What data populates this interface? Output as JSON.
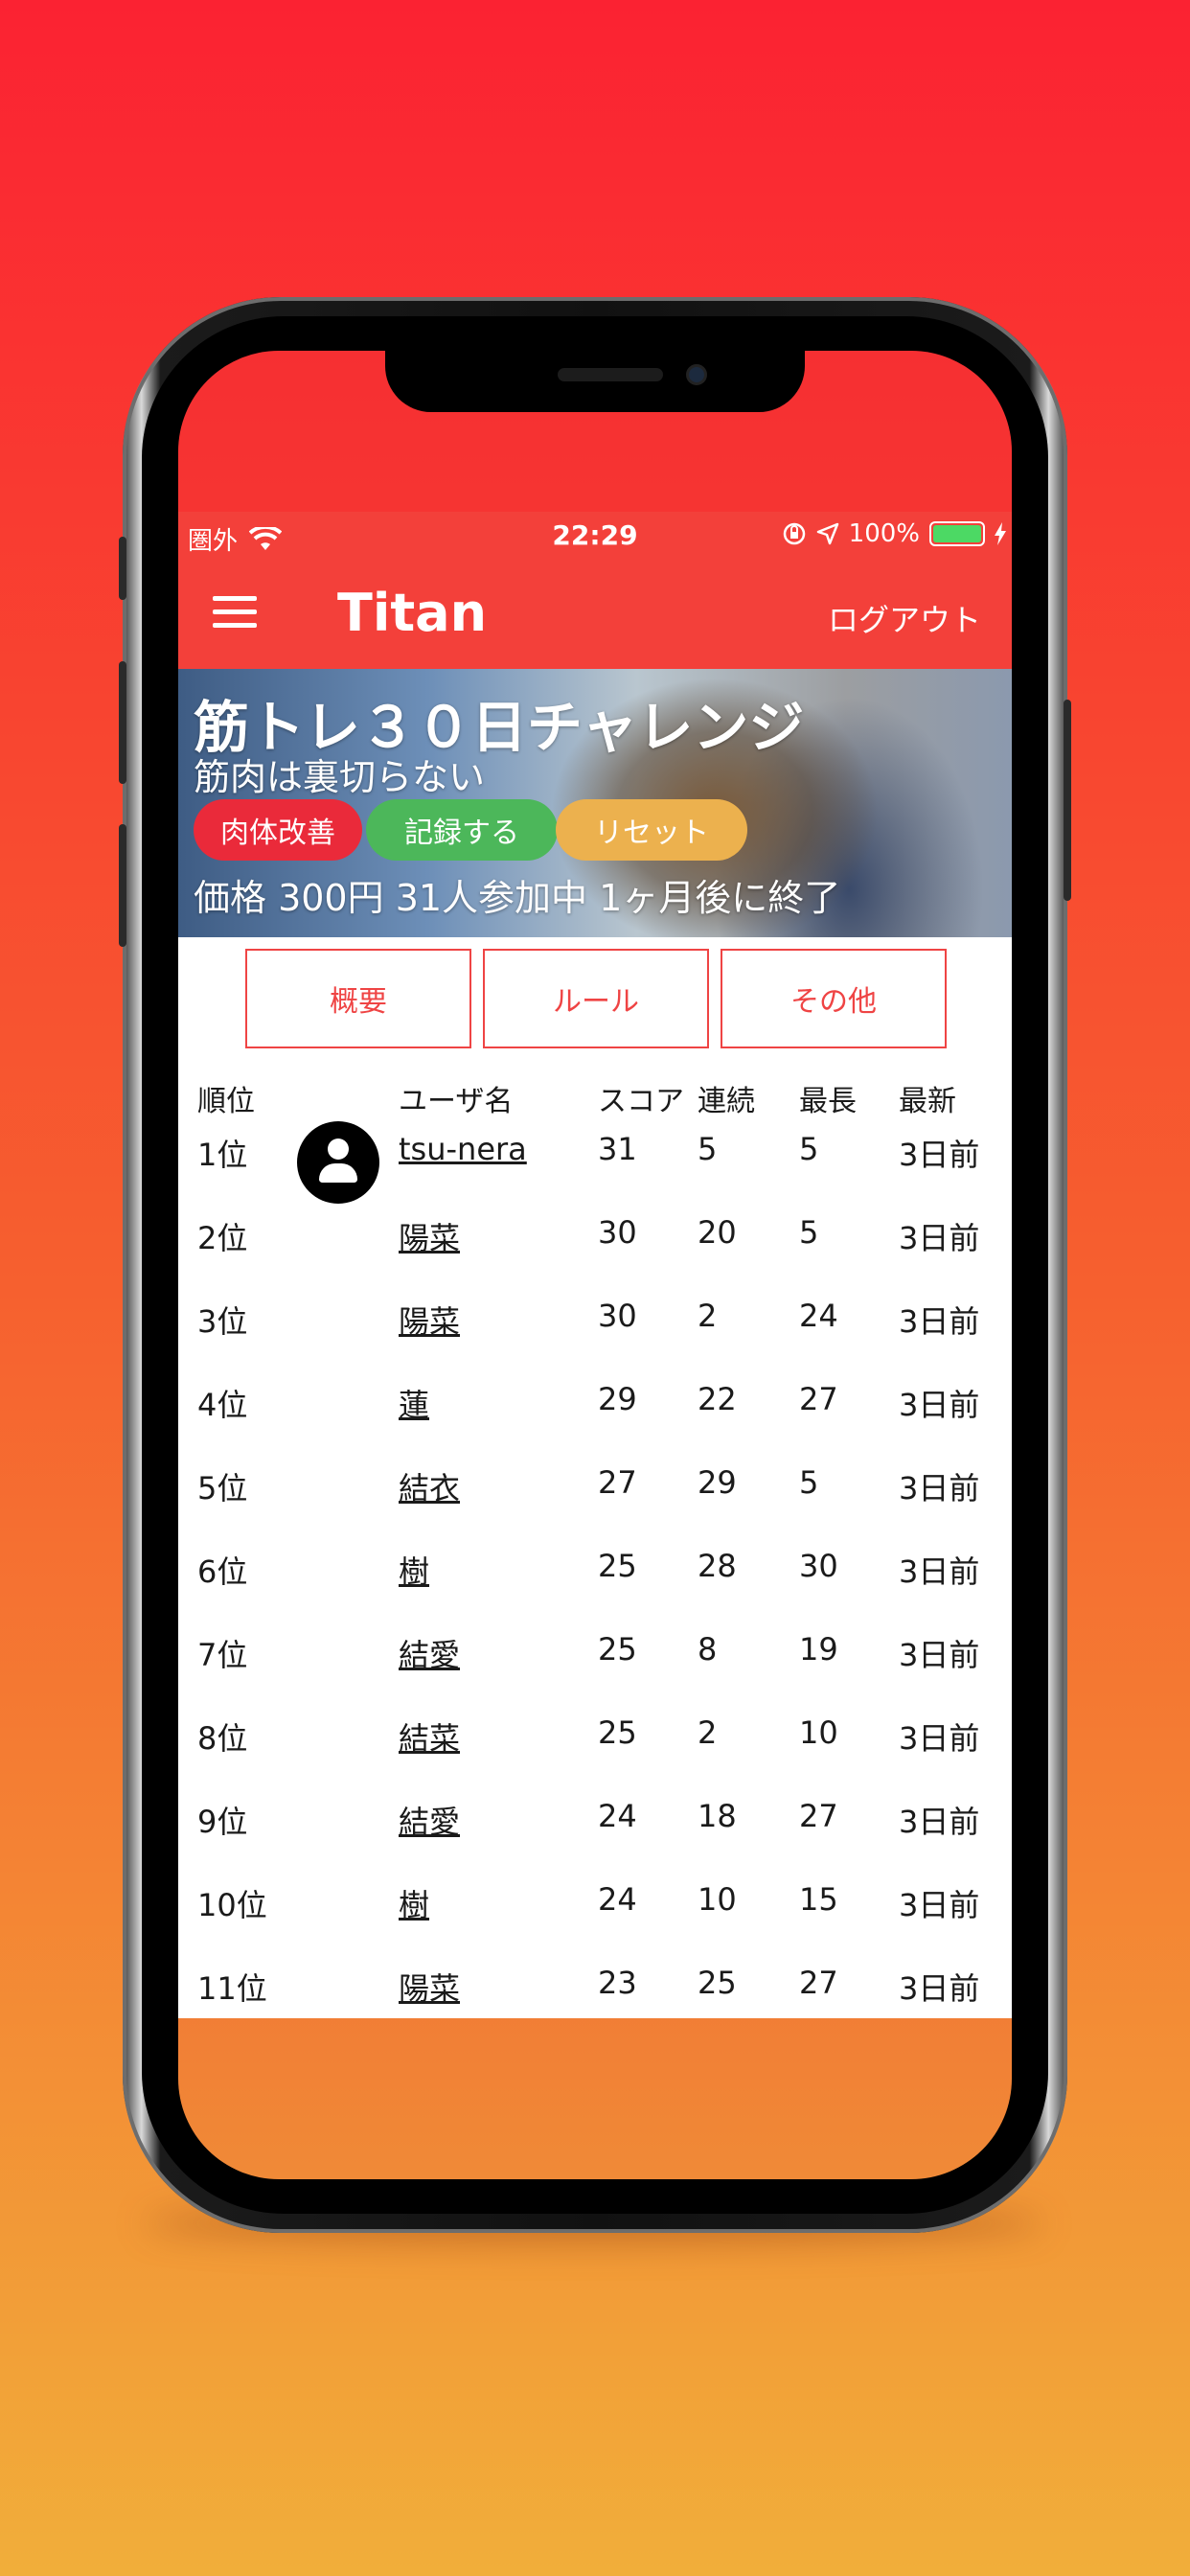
{
  "status_bar": {
    "carrier": "圏外",
    "time": "22:29",
    "battery_percent": "100%"
  },
  "nav": {
    "title": "Titan",
    "logout_label": "ログアウト"
  },
  "banner": {
    "title": "筋トレ３０日チャレンジ",
    "subtitle": "筋肉は裏切らない",
    "tag_label": "肉体改善",
    "record_label": "記録する",
    "reset_label": "リセット",
    "info": "価格 300円 31人参加中 1ヶ月後に終了"
  },
  "tabs": [
    {
      "label": "概要"
    },
    {
      "label": "ルール"
    },
    {
      "label": "その他"
    }
  ],
  "table": {
    "headers": {
      "rank": "順位",
      "name": "ユーザ名",
      "score": "スコア",
      "streak": "連続",
      "max": "最長",
      "last": "最新"
    },
    "rows": [
      {
        "rank": "1位",
        "name": "tsu-nera",
        "score": "31",
        "streak": "5",
        "max": "5",
        "last": "3日前"
      },
      {
        "rank": "2位",
        "name": "陽菜",
        "score": "30",
        "streak": "20",
        "max": "5",
        "last": "3日前"
      },
      {
        "rank": "3位",
        "name": "陽菜",
        "score": "30",
        "streak": "2",
        "max": "24",
        "last": "3日前"
      },
      {
        "rank": "4位",
        "name": "蓮",
        "score": "29",
        "streak": "22",
        "max": "27",
        "last": "3日前"
      },
      {
        "rank": "5位",
        "name": "結衣",
        "score": "27",
        "streak": "29",
        "max": "5",
        "last": "3日前"
      },
      {
        "rank": "6位",
        "name": "樹",
        "score": "25",
        "streak": "28",
        "max": "30",
        "last": "3日前"
      },
      {
        "rank": "7位",
        "name": "結愛",
        "score": "25",
        "streak": "8",
        "max": "19",
        "last": "3日前"
      },
      {
        "rank": "8位",
        "name": "結菜",
        "score": "25",
        "streak": "2",
        "max": "10",
        "last": "3日前"
      },
      {
        "rank": "9位",
        "name": "結愛",
        "score": "24",
        "streak": "18",
        "max": "27",
        "last": "3日前"
      },
      {
        "rank": "10位",
        "name": "樹",
        "score": "24",
        "streak": "10",
        "max": "15",
        "last": "3日前"
      },
      {
        "rank": "11位",
        "name": "陽菜",
        "score": "23",
        "streak": "25",
        "max": "27",
        "last": "3日前"
      }
    ]
  },
  "colors": {
    "accent": "#f3403a",
    "tag_red": "#ea2a3a",
    "record_green": "#4cb75a",
    "reset_orange": "#ecb14e",
    "battery_green": "#4cd964"
  }
}
